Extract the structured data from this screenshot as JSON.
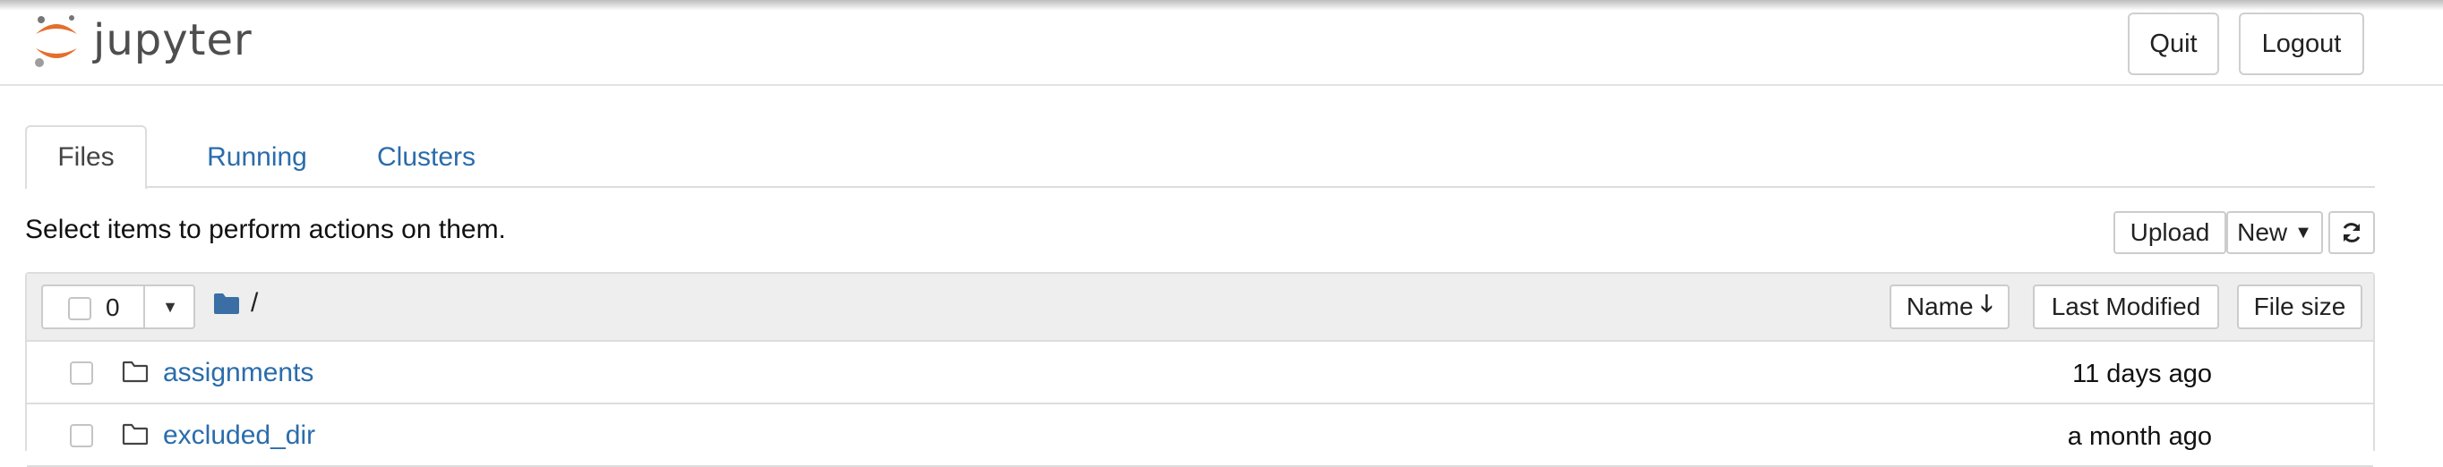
{
  "app": {
    "logo_text": "jupyter",
    "quit_label": "Quit",
    "logout_label": "Logout"
  },
  "tabs": [
    {
      "label": "Files",
      "active": true
    },
    {
      "label": "Running",
      "active": false
    },
    {
      "label": "Clusters",
      "active": false
    }
  ],
  "toolbar": {
    "instructions": "Select items to perform actions on them.",
    "upload_label": "Upload",
    "new_label": "New",
    "refresh_icon": "refresh-icon"
  },
  "list_header": {
    "selected_count": "0",
    "breadcrumb_root": "/",
    "sort_name_label": "Name",
    "sort_name_icon": "arrow-down-icon",
    "sort_modified_label": "Last Modified",
    "sort_size_label": "File size"
  },
  "files": [
    {
      "name": "assignments",
      "type": "folder",
      "modified": "11 days ago"
    },
    {
      "name": "excluded_dir",
      "type": "folder",
      "modified": "a month ago"
    }
  ],
  "colors": {
    "link": "#2a6cab",
    "logo_orange": "#e46e2e",
    "folder_blue": "#3a6ea5"
  }
}
